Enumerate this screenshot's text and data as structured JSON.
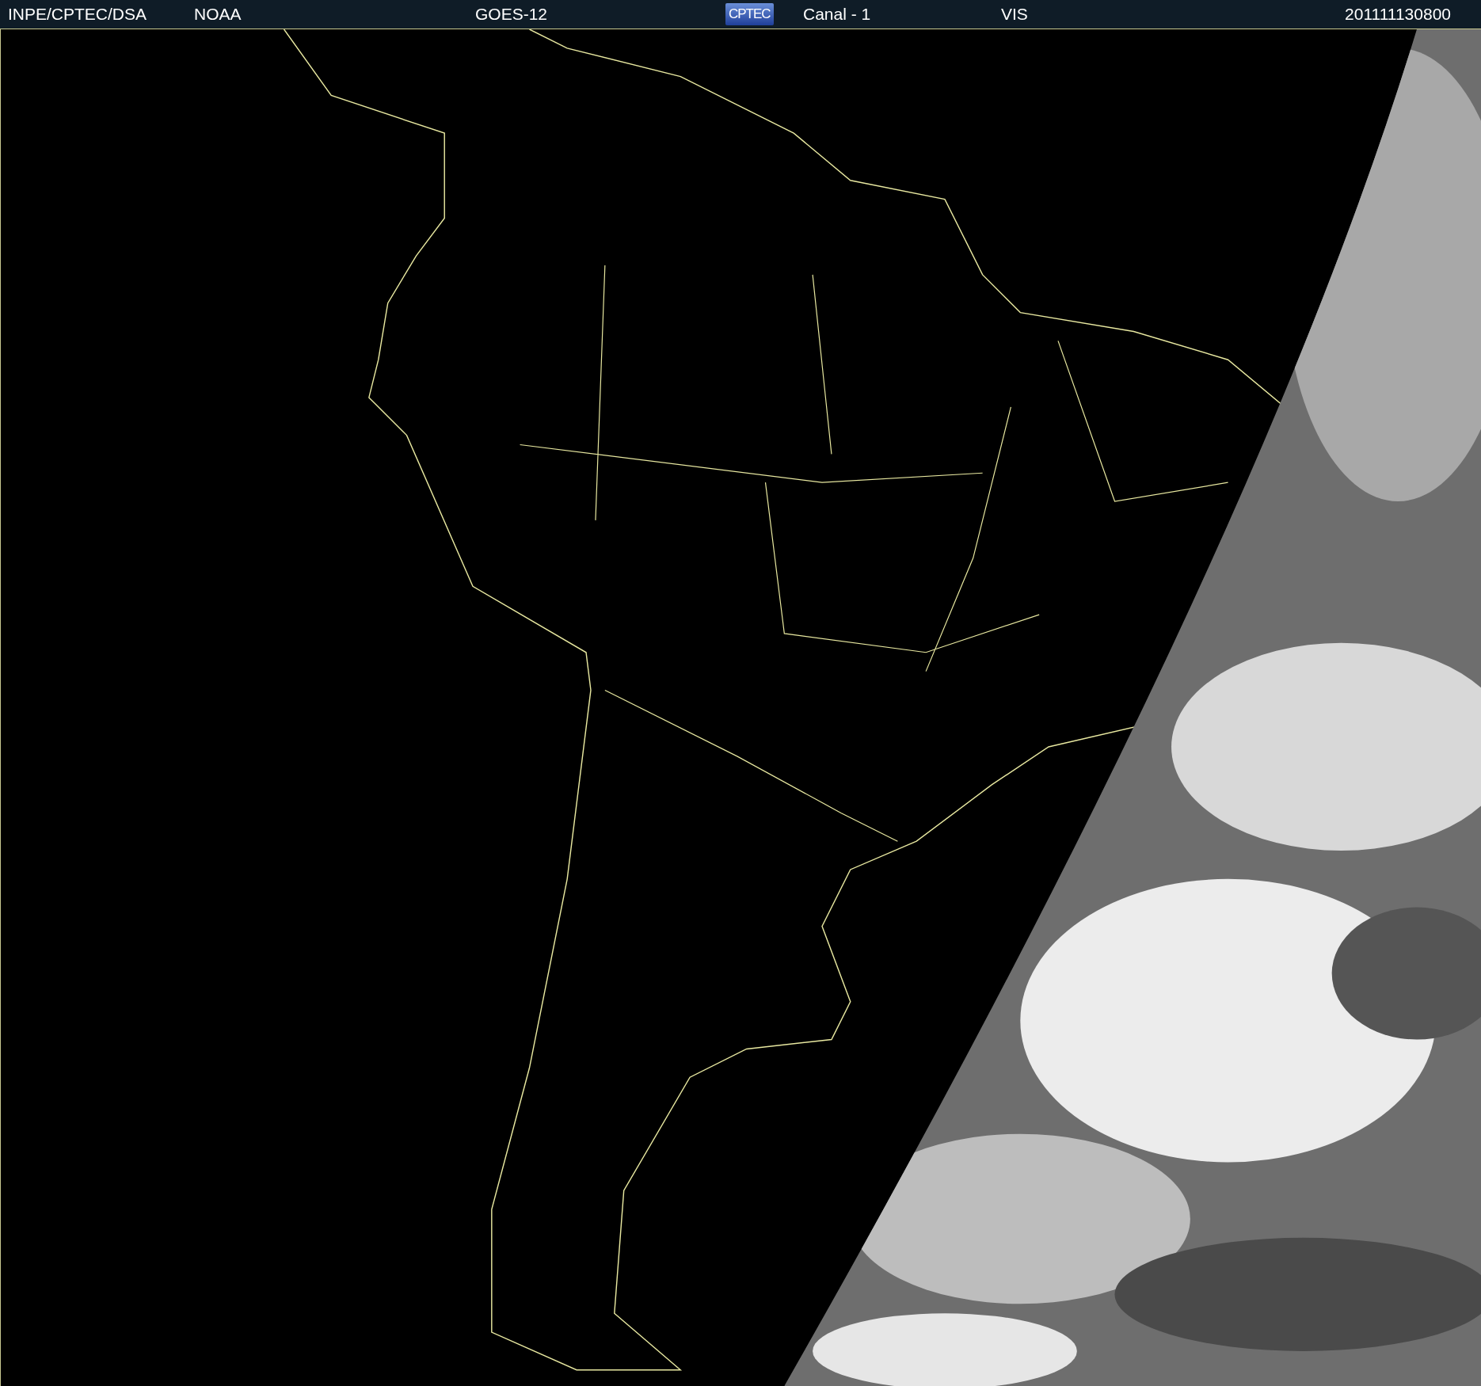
{
  "header": {
    "source": "INPE/CPTEC/DSA",
    "agency": "NOAA",
    "satellite": "GOES-12",
    "logo": "CPTEC",
    "channel": "Canal - 1",
    "band": "VIS",
    "timestamp": "201111130800"
  }
}
